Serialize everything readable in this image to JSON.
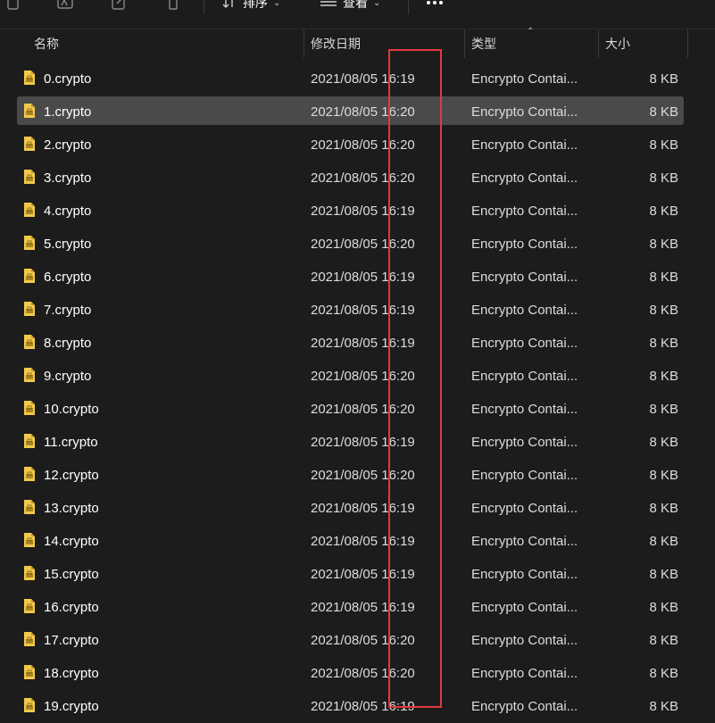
{
  "toolbar": {
    "sort_label": "排序",
    "view_label": "查看",
    "more_label": "..."
  },
  "columns": {
    "name": "名称",
    "modified": "修改日期",
    "type": "类型",
    "size": "大小"
  },
  "files": [
    {
      "name": "0.crypto",
      "date": "2021/08/05 16:19",
      "type": "Encrypto Contai...",
      "size": "8 KB"
    },
    {
      "name": "1.crypto",
      "date": "2021/08/05 16:20",
      "type": "Encrypto Contai...",
      "size": "8 KB",
      "selected": true
    },
    {
      "name": "2.crypto",
      "date": "2021/08/05 16:20",
      "type": "Encrypto Contai...",
      "size": "8 KB"
    },
    {
      "name": "3.crypto",
      "date": "2021/08/05 16:20",
      "type": "Encrypto Contai...",
      "size": "8 KB"
    },
    {
      "name": "4.crypto",
      "date": "2021/08/05 16:19",
      "type": "Encrypto Contai...",
      "size": "8 KB"
    },
    {
      "name": "5.crypto",
      "date": "2021/08/05 16:20",
      "type": "Encrypto Contai...",
      "size": "8 KB"
    },
    {
      "name": "6.crypto",
      "date": "2021/08/05 16:19",
      "type": "Encrypto Contai...",
      "size": "8 KB"
    },
    {
      "name": "7.crypto",
      "date": "2021/08/05 16:19",
      "type": "Encrypto Contai...",
      "size": "8 KB"
    },
    {
      "name": "8.crypto",
      "date": "2021/08/05 16:19",
      "type": "Encrypto Contai...",
      "size": "8 KB"
    },
    {
      "name": "9.crypto",
      "date": "2021/08/05 16:20",
      "type": "Encrypto Contai...",
      "size": "8 KB"
    },
    {
      "name": "10.crypto",
      "date": "2021/08/05 16:20",
      "type": "Encrypto Contai...",
      "size": "8 KB"
    },
    {
      "name": "11.crypto",
      "date": "2021/08/05 16:19",
      "type": "Encrypto Contai...",
      "size": "8 KB"
    },
    {
      "name": "12.crypto",
      "date": "2021/08/05 16:20",
      "type": "Encrypto Contai...",
      "size": "8 KB"
    },
    {
      "name": "13.crypto",
      "date": "2021/08/05 16:19",
      "type": "Encrypto Contai...",
      "size": "8 KB"
    },
    {
      "name": "14.crypto",
      "date": "2021/08/05 16:19",
      "type": "Encrypto Contai...",
      "size": "8 KB"
    },
    {
      "name": "15.crypto",
      "date": "2021/08/05 16:19",
      "type": "Encrypto Contai...",
      "size": "8 KB"
    },
    {
      "name": "16.crypto",
      "date": "2021/08/05 16:19",
      "type": "Encrypto Contai...",
      "size": "8 KB"
    },
    {
      "name": "17.crypto",
      "date": "2021/08/05 16:20",
      "type": "Encrypto Contai...",
      "size": "8 KB"
    },
    {
      "name": "18.crypto",
      "date": "2021/08/05 16:20",
      "type": "Encrypto Contai...",
      "size": "8 KB"
    },
    {
      "name": "19.crypto",
      "date": "2021/08/05 16:19",
      "type": "Encrypto Contai...",
      "size": "8 KB"
    }
  ],
  "colors": {
    "background": "#1c1c1c",
    "selected_row": "#4a4a4a",
    "annotation": "#e0393e",
    "file_icon": "#f2c94c"
  },
  "icons": {
    "file": "encrypted-file-icon",
    "sort": "sort-arrows-icon",
    "view": "view-lines-icon",
    "more": "more-dots-icon"
  }
}
